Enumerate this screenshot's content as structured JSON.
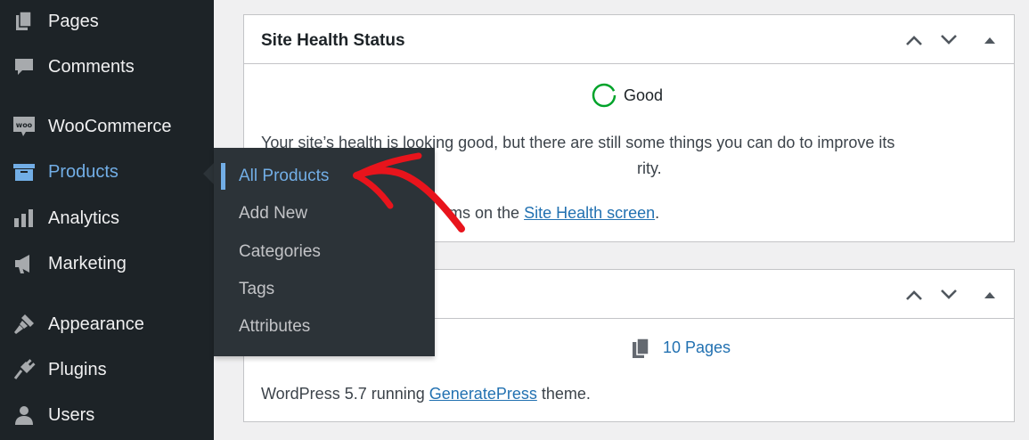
{
  "sidebar": {
    "items": [
      {
        "label": "Pages",
        "icon": "pages-icon"
      },
      {
        "label": "Comments",
        "icon": "comment-icon"
      },
      {
        "label": "WooCommerce",
        "icon": "woocommerce-icon"
      },
      {
        "label": "Products",
        "icon": "archive-box-icon"
      },
      {
        "label": "Analytics",
        "icon": "bar-chart-icon"
      },
      {
        "label": "Marketing",
        "icon": "megaphone-icon"
      },
      {
        "label": "Appearance",
        "icon": "paintbrush-icon"
      },
      {
        "label": "Plugins",
        "icon": "plug-icon"
      },
      {
        "label": "Users",
        "icon": "user-icon"
      }
    ]
  },
  "flyout": {
    "items": [
      "All Products",
      "Add New",
      "Categories",
      "Tags",
      "Attributes"
    ]
  },
  "site_health": {
    "title": "Site Health Status",
    "status": "Good",
    "message_line1": "Your site’s health is looking good, but there are still some things you can do to improve its",
    "message_line2_tail": "rity.",
    "items_prefix_tail": "ms on the",
    "link": "Site Health screen",
    "link_suffix": "."
  },
  "glance": {
    "pages_count": "10 Pages",
    "wp_text": "WordPress 5.7 running",
    "theme_link": "GeneratePress",
    "theme_suffix": "theme."
  },
  "colors": {
    "sidebar_bg": "#1d2327",
    "flyout_bg": "#2c3338",
    "accent": "#72aee6",
    "link": "#2271b1",
    "good": "#00a32a",
    "annotation": "#e8141c"
  }
}
